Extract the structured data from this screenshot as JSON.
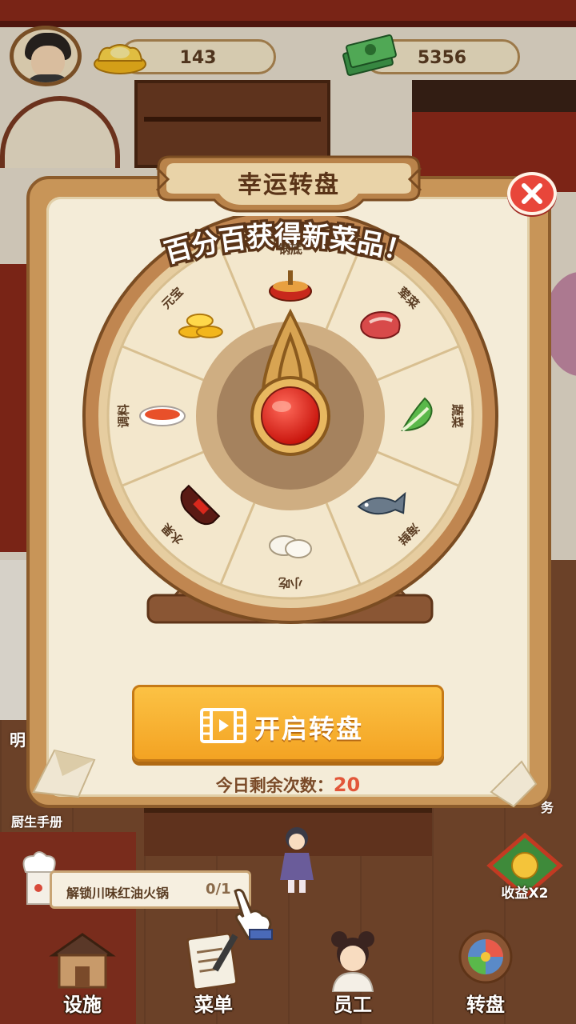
{
  "hud": {
    "gold_value": "143",
    "cash_value": "5356"
  },
  "modal": {
    "title": "幸运转盘",
    "banner": "百分百获得新菜品！",
    "segments": [
      {
        "label": "锅底",
        "icon": "hotpot-icon"
      },
      {
        "label": "荤菜",
        "icon": "meat-icon"
      },
      {
        "label": "蔬菜",
        "icon": "vegetable-icon"
      },
      {
        "label": "海鲜",
        "icon": "fish-icon"
      },
      {
        "label": "小吃",
        "icon": "dumpling-icon"
      },
      {
        "label": "水果",
        "icon": "cola-bottle-icon"
      },
      {
        "label": "调料",
        "icon": "sauce-bowl-icon"
      },
      {
        "label": "元宝",
        "icon": "gold-ingot-icon"
      }
    ],
    "spin_button": "开启转盘",
    "remaining_label": "今日剩余次数：",
    "remaining_count": "20"
  },
  "scene": {
    "side_char": "明",
    "left_label": "厨生手册",
    "right_label": "务",
    "task_text": "解锁川味红油火锅",
    "task_progress": "0/1",
    "bonus_label": "收益X2"
  },
  "nav": [
    {
      "label": "设施",
      "icon": "facility-icon"
    },
    {
      "label": "菜单",
      "icon": "menu-icon"
    },
    {
      "label": "员工",
      "icon": "staff-icon"
    },
    {
      "label": "转盘",
      "icon": "wheel-icon"
    }
  ],
  "colors": {
    "panel_wood": "#c89558",
    "panel_cream": "#f4ecd8",
    "spin_button": "#f7b02e",
    "close_button": "#e8463a",
    "count_red": "#e2573a"
  }
}
